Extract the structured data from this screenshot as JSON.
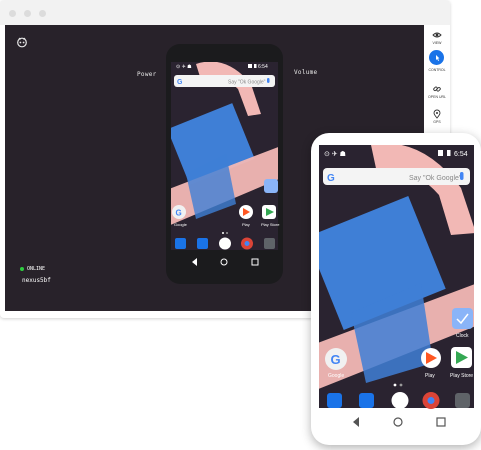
{
  "window": {
    "titlebar_dots": 3
  },
  "stage": {
    "button_labels": {
      "power": "Power",
      "volume": "Volume"
    },
    "connection": {
      "status": "ONLINE",
      "device": "nexus5bf"
    }
  },
  "sidebar": {
    "items": [
      {
        "label": "VIEW",
        "icon": "eye-icon"
      },
      {
        "label": "CONTROL",
        "icon": "pointer-icon"
      },
      {
        "label": "OPEN URL",
        "icon": "link-icon"
      },
      {
        "label": "GPS",
        "icon": "location-pin-icon"
      }
    ],
    "active": "CONTROL",
    "accent": "#1a73e8"
  },
  "small_phone": {
    "status_time": "6:54",
    "search_placeholder": "Say \"Ok Google\"",
    "apps": [
      {
        "label": "Google",
        "icon": "google-icon"
      },
      {
        "label": "Play",
        "icon": "play-music-icon"
      },
      {
        "label": "Play Store",
        "icon": "play-store-icon"
      }
    ],
    "dock": [
      "phone-icon",
      "messages-icon",
      "app-drawer-icon",
      "chrome-icon",
      "camera-icon"
    ]
  },
  "big_phone": {
    "status_time": "6:54",
    "search_placeholder": "Say \"Ok Google\"",
    "clock_label": "Clock",
    "apps": [
      {
        "label": "Google",
        "icon": "google-icon"
      },
      {
        "label": "Play",
        "icon": "play-music-icon"
      },
      {
        "label": "Play Store",
        "icon": "play-store-icon"
      }
    ],
    "dock": [
      "phone-icon",
      "messages-icon",
      "app-drawer-icon",
      "chrome-icon",
      "camera-icon"
    ]
  },
  "colors": {
    "stage_bg": "#28222a",
    "wallpaper_bg": "#2a2330",
    "pink": "#f2b8b5",
    "blue": "#3f7fd6",
    "online": "#2ecc40"
  }
}
